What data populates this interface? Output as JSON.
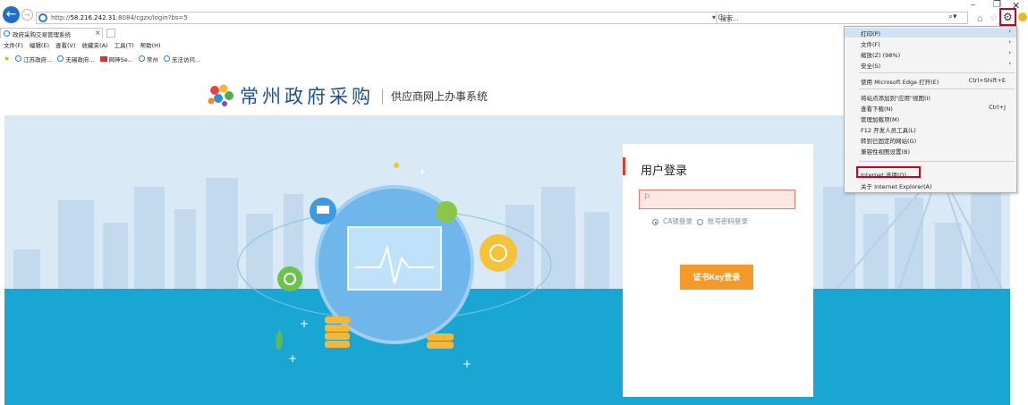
{
  "browser": {
    "url_prefix": "http://",
    "url_host": "58.216.242.31",
    "url_path": ":8084/cgzx/login?bs=5",
    "url_tools": "▾ C",
    "search_placeholder": "搜索...",
    "tab_title": "政府采购交易管理系统",
    "menu_bar": [
      "文件(F)",
      "编辑(E)",
      "查看(V)",
      "收藏夹(A)",
      "工具(T)",
      "帮助(H)"
    ],
    "favorites": [
      "江苏政府...",
      "无锡政府...",
      "网神Se...",
      "常州",
      "无法访问..."
    ]
  },
  "site": {
    "title": "常州政府采购",
    "subtitle": "供应商网上办事系统"
  },
  "login": {
    "title": "用户登录",
    "ca_input_value": "",
    "option_ca": "CA锁登录",
    "option_account": "账号密码登录",
    "submit_label": "证书Key登录"
  },
  "tools_menu": {
    "items": [
      {
        "label": "打印(P)",
        "shortcut": "",
        "submenu": true,
        "highlighted": true
      },
      {
        "label": "文件(F)",
        "shortcut": "",
        "submenu": true,
        "highlighted": false
      },
      {
        "label": "缩放(Z) (98%)",
        "shortcut": "",
        "submenu": true,
        "highlighted": false
      },
      {
        "label": "安全(S)",
        "shortcut": "",
        "submenu": true,
        "highlighted": false
      },
      {
        "label": "使用 Microsoft Edge 打开(E)",
        "shortcut": "Ctrl+Shift+E",
        "submenu": false,
        "highlighted": false
      },
      {
        "label": "将站点添加到\"应用\"视图(I)",
        "shortcut": "",
        "submenu": false,
        "highlighted": false
      },
      {
        "label": "查看下载(N)",
        "shortcut": "Ctrl+J",
        "submenu": false,
        "highlighted": false
      },
      {
        "label": "管理加载项(M)",
        "shortcut": "",
        "submenu": false,
        "highlighted": false
      },
      {
        "label": "F12 开发人员工具(L)",
        "shortcut": "",
        "submenu": false,
        "highlighted": false
      },
      {
        "label": "转到已固定的网站(G)",
        "shortcut": "",
        "submenu": false,
        "highlighted": false
      },
      {
        "label": "兼容性视图设置(B)",
        "shortcut": "",
        "submenu": false,
        "highlighted": false
      },
      {
        "label": "Internet 选项(O)",
        "shortcut": "",
        "submenu": false,
        "highlighted": false
      },
      {
        "label": "关于 Internet Explorer(A)",
        "shortcut": "",
        "submenu": false,
        "highlighted": false
      }
    ]
  },
  "colors": {
    "accent_red": "#d0021b",
    "button_orange": "#f39a2a",
    "brand_blue": "#1d4fa0",
    "banner_blue": "#1aa6d3"
  }
}
